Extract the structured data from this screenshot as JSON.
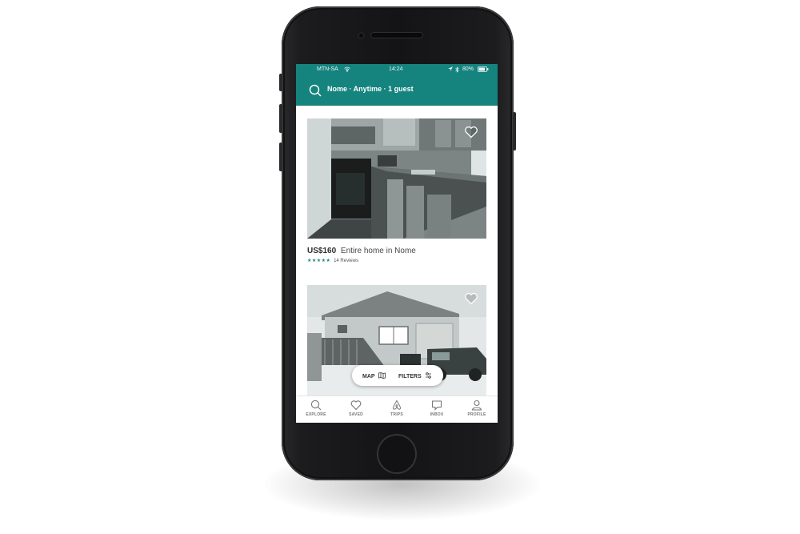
{
  "status_bar": {
    "carrier": "MTN-SA",
    "time": "14:24",
    "battery": "80%"
  },
  "search": {
    "summary": "Nome · Anytime · 1 guest"
  },
  "listings": [
    {
      "price": "US$160",
      "title": "Entire home in Nome",
      "reviews": "14 Reviews",
      "stars": "★★★★★",
      "star_count": 5
    },
    {
      "photo": "house-exterior"
    }
  ],
  "floating_bar": {
    "map_label": "MAP",
    "filters_label": "FILTERS"
  },
  "tab_bar": {
    "items": [
      {
        "label": "EXPLORE",
        "icon": "search-icon"
      },
      {
        "label": "SAVED",
        "icon": "heart-icon"
      },
      {
        "label": "TRIPS",
        "icon": "airbnb-logo-icon"
      },
      {
        "label": "INBOX",
        "icon": "chat-bubble-icon"
      },
      {
        "label": "PROFILE",
        "icon": "person-icon"
      }
    ]
  },
  "colors": {
    "brand_teal": "#15837e",
    "star": "#15837e"
  }
}
